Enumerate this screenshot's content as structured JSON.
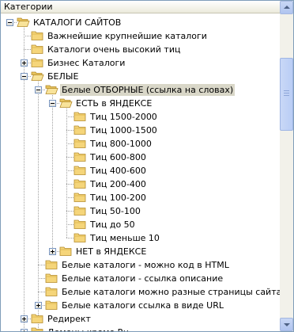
{
  "header": {
    "title": "Категории"
  },
  "tree": [
    {
      "label": "КАТАЛОГИ САЙТОВ",
      "level": 0,
      "expander": "minus",
      "open": true
    },
    {
      "label": "Важнейшие крупнейшие каталоги",
      "level": 1,
      "expander": "none"
    },
    {
      "label": "Каталоги очень высокий тиц",
      "level": 1,
      "expander": "none"
    },
    {
      "label": "Бизнес Каталоги",
      "level": 1,
      "expander": "plus"
    },
    {
      "label": "БЕЛЫЕ",
      "level": 1,
      "expander": "minus",
      "open": true
    },
    {
      "label": "Белые ОТБОРНЫЕ (ссылка на словах)",
      "level": 2,
      "expander": "minus",
      "open": true,
      "selected": true
    },
    {
      "label": "ЕСТЬ в ЯНДЕКСЕ",
      "level": 3,
      "expander": "minus",
      "open": true
    },
    {
      "label": "Тиц 1500-2000",
      "level": 4,
      "expander": "none"
    },
    {
      "label": "Тиц 1000-1500",
      "level": 4,
      "expander": "none"
    },
    {
      "label": "Тиц 800-1000",
      "level": 4,
      "expander": "none"
    },
    {
      "label": "Тиц 600-800",
      "level": 4,
      "expander": "none"
    },
    {
      "label": "Тиц 400-600",
      "level": 4,
      "expander": "none"
    },
    {
      "label": "Тиц 200-400",
      "level": 4,
      "expander": "none"
    },
    {
      "label": "Тиц 100-200",
      "level": 4,
      "expander": "none"
    },
    {
      "label": "Тиц 50-100",
      "level": 4,
      "expander": "none"
    },
    {
      "label": "Тиц до 50",
      "level": 4,
      "expander": "none"
    },
    {
      "label": "Тиц меньше 10",
      "level": 4,
      "expander": "none"
    },
    {
      "label": "НЕТ в ЯНДЕКСЕ",
      "level": 3,
      "expander": "plus"
    },
    {
      "label": "Белые каталоги - можно код в HTML",
      "level": 2,
      "expander": "none"
    },
    {
      "label": "Белые каталоги - ссылка описание",
      "level": 2,
      "expander": "none"
    },
    {
      "label": "Белые каталоги можно разные страницы сайта",
      "level": 2,
      "expander": "none"
    },
    {
      "label": "Белые каталоги ссылка в виде URL",
      "level": 2,
      "expander": "plus"
    },
    {
      "label": "Редирект",
      "level": 1,
      "expander": "plus"
    },
    {
      "label": "Домены кроме Ru",
      "level": 1,
      "expander": "plus"
    }
  ],
  "icons": {
    "expander": "expand-collapse-icon",
    "folder": "folder-icon"
  },
  "colors": {
    "folder": "#f5d57a",
    "folder_open": "#f8e39a",
    "selection": "#d9d7c8",
    "scrollbar": "#c8d7f5",
    "border": "#7f9db9"
  }
}
